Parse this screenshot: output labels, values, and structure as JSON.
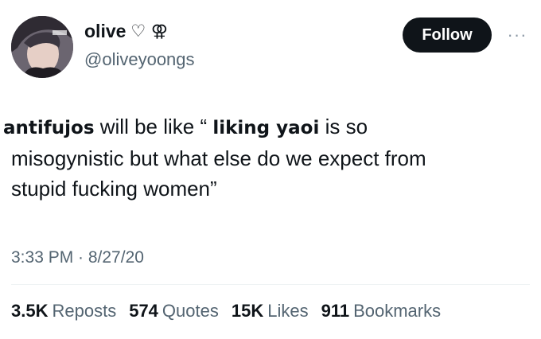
{
  "author": {
    "display_name": "olive",
    "symbols": "♡ ⚢",
    "handle": "@oliveyoongs"
  },
  "follow_label": "Follow",
  "more_label": "···",
  "tweet": {
    "bold_1": "antifujos",
    "text_1": " will be like “ ",
    "bold_2": "liking yaoi",
    "text_2": "  is so",
    "line_2": "misogynistic but what else do we expect from",
    "line_3": "stupid fucking women”"
  },
  "timestamp": "3:33 PM · 8/27/20",
  "stats": [
    {
      "value": "3.5K",
      "label": "Reposts"
    },
    {
      "value": "574",
      "label": "Quotes"
    },
    {
      "value": "15K",
      "label": "Likes"
    },
    {
      "value": "911",
      "label": "Bookmarks"
    }
  ],
  "colors": {
    "text": "#0f1419",
    "secondary": "#536471",
    "button_bg": "#0f1419",
    "divider": "#eff3f4"
  }
}
